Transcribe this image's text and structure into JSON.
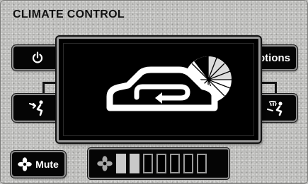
{
  "header": {
    "title": "CLIMATE CONTROL"
  },
  "buttons": {
    "power_icon": "power-icon",
    "options_label": "Options",
    "mute_label": "Mute",
    "mute_icon": "fan-icon"
  },
  "fan_speed": {
    "level": 2,
    "max": 7,
    "icon": "fan-icon"
  },
  "overlay": {
    "mode": "recirculation",
    "icon": "recirculate-car-icon"
  },
  "colors": {
    "panel": "#b8b8b6",
    "button": "#050505",
    "segment_on": "#c9c9c9"
  }
}
